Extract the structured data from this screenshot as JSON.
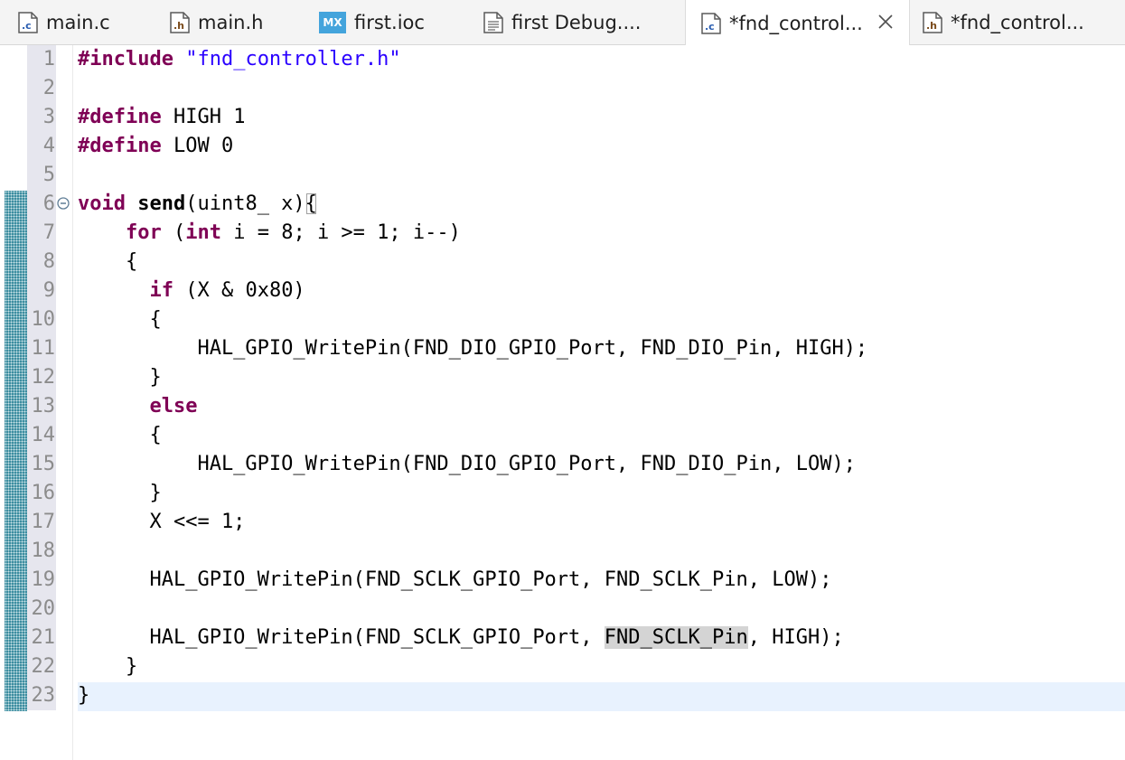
{
  "tabs": [
    {
      "name": "tab-main-c",
      "icon": "c-source-file-icon",
      "label": "main.c",
      "active": false
    },
    {
      "name": "tab-main-h",
      "icon": "h-header-file-icon",
      "label": "main.h",
      "active": false
    },
    {
      "name": "tab-first-ioc",
      "icon": "mx-cube-icon",
      "icon_text": "MX",
      "label": "first.ioc",
      "active": false
    },
    {
      "name": "tab-first-debug",
      "icon": "launch-config-file-icon",
      "label": "first Debug....",
      "active": false
    },
    {
      "name": "tab-fnd-controller-c",
      "icon": "c-source-file-icon",
      "label": "*fnd_control...",
      "active": true
    },
    {
      "name": "tab-fnd-controller-h",
      "icon": "h-header-file-icon",
      "label": "*fnd_control...",
      "active": false
    }
  ],
  "icon_letters": {
    "c": ".c",
    "h": ".h"
  },
  "editor": {
    "line_numbers": [
      "1",
      "2",
      "3",
      "4",
      "5",
      "6",
      "7",
      "8",
      "9",
      "10",
      "11",
      "12",
      "13",
      "14",
      "15",
      "16",
      "17",
      "18",
      "19",
      "20",
      "21",
      "22",
      "23"
    ],
    "current_line": 23,
    "lines": {
      "l1": {
        "kw": "#include",
        "sp": " ",
        "str": "\"fnd_controller.h\""
      },
      "l3": {
        "kw": "#define",
        "rest": " HIGH 1"
      },
      "l4": {
        "kw": "#define",
        "rest": " LOW 0"
      },
      "l6": {
        "kw": "void",
        "sp": " ",
        "fn": "send",
        "a": "(uint8_ x)",
        "b": "{"
      },
      "l7": {
        "indent": "    ",
        "kw1": "for",
        "a": " (",
        "kw2": "int",
        "b": " i = 8; i >= 1; i--)"
      },
      "l8": {
        "text": "    {"
      },
      "l9": {
        "indent": "      ",
        "kw": "if",
        "rest": " (X & 0x80)"
      },
      "l10": {
        "text": "      {"
      },
      "l11": {
        "text": "          HAL_GPIO_WritePin(FND_DIO_GPIO_Port, FND_DIO_Pin, HIGH);"
      },
      "l12": {
        "text": "      }"
      },
      "l13": {
        "indent": "      ",
        "kw": "else"
      },
      "l14": {
        "text": "      {"
      },
      "l15": {
        "text": "          HAL_GPIO_WritePin(FND_DIO_GPIO_Port, FND_DIO_Pin, LOW);"
      },
      "l16": {
        "text": "      }"
      },
      "l17": {
        "text": "      X <<= 1;"
      },
      "l19": {
        "text": "      HAL_GPIO_WritePin(FND_SCLK_GPIO_Port, FND_SCLK_Pin, LOW);"
      },
      "l21": {
        "a": "      HAL_GPIO_WritePin(FND_SCLK_GPIO_Port, ",
        "hl": "FND_SCLK_Pin",
        "b": ", HIGH);"
      },
      "l22": {
        "text": "    }"
      },
      "l23": {
        "text": "}"
      }
    }
  },
  "colors": {
    "keyword": "#7f0055",
    "string": "#2a00ff",
    "line_number": "#8c8c8c",
    "gutter": "#e6e6ee",
    "current_line": "#e8f2fe",
    "occurrence_highlight": "#d4d4d4",
    "overview_ruler": "#3c8da0"
  }
}
